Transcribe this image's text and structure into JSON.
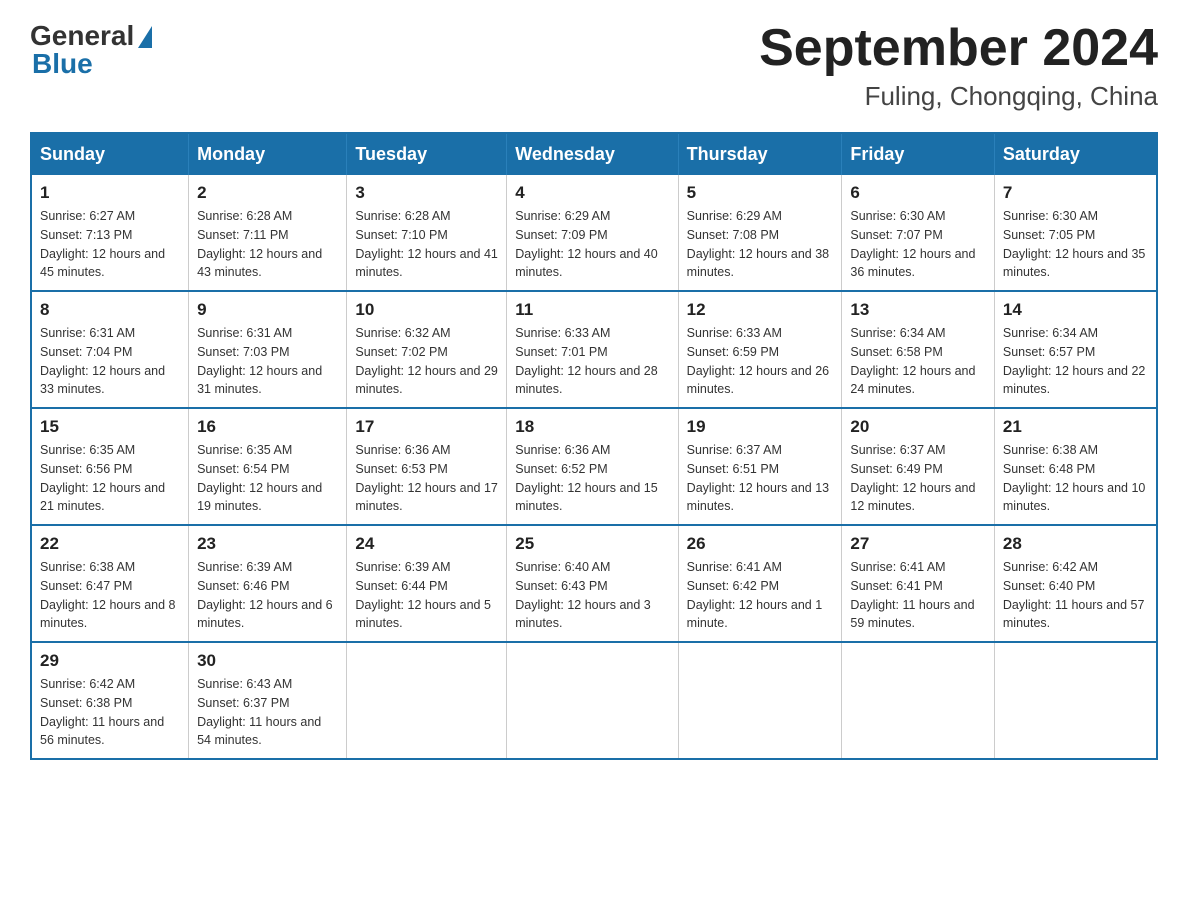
{
  "logo": {
    "general": "General",
    "blue": "Blue"
  },
  "title": "September 2024",
  "location": "Fuling, Chongqing, China",
  "days_header": [
    "Sunday",
    "Monday",
    "Tuesday",
    "Wednesday",
    "Thursday",
    "Friday",
    "Saturday"
  ],
  "weeks": [
    [
      {
        "day": "1",
        "sunrise": "6:27 AM",
        "sunset": "7:13 PM",
        "daylight": "12 hours and 45 minutes."
      },
      {
        "day": "2",
        "sunrise": "6:28 AM",
        "sunset": "7:11 PM",
        "daylight": "12 hours and 43 minutes."
      },
      {
        "day": "3",
        "sunrise": "6:28 AM",
        "sunset": "7:10 PM",
        "daylight": "12 hours and 41 minutes."
      },
      {
        "day": "4",
        "sunrise": "6:29 AM",
        "sunset": "7:09 PM",
        "daylight": "12 hours and 40 minutes."
      },
      {
        "day": "5",
        "sunrise": "6:29 AM",
        "sunset": "7:08 PM",
        "daylight": "12 hours and 38 minutes."
      },
      {
        "day": "6",
        "sunrise": "6:30 AM",
        "sunset": "7:07 PM",
        "daylight": "12 hours and 36 minutes."
      },
      {
        "day": "7",
        "sunrise": "6:30 AM",
        "sunset": "7:05 PM",
        "daylight": "12 hours and 35 minutes."
      }
    ],
    [
      {
        "day": "8",
        "sunrise": "6:31 AM",
        "sunset": "7:04 PM",
        "daylight": "12 hours and 33 minutes."
      },
      {
        "day": "9",
        "sunrise": "6:31 AM",
        "sunset": "7:03 PM",
        "daylight": "12 hours and 31 minutes."
      },
      {
        "day": "10",
        "sunrise": "6:32 AM",
        "sunset": "7:02 PM",
        "daylight": "12 hours and 29 minutes."
      },
      {
        "day": "11",
        "sunrise": "6:33 AM",
        "sunset": "7:01 PM",
        "daylight": "12 hours and 28 minutes."
      },
      {
        "day": "12",
        "sunrise": "6:33 AM",
        "sunset": "6:59 PM",
        "daylight": "12 hours and 26 minutes."
      },
      {
        "day": "13",
        "sunrise": "6:34 AM",
        "sunset": "6:58 PM",
        "daylight": "12 hours and 24 minutes."
      },
      {
        "day": "14",
        "sunrise": "6:34 AM",
        "sunset": "6:57 PM",
        "daylight": "12 hours and 22 minutes."
      }
    ],
    [
      {
        "day": "15",
        "sunrise": "6:35 AM",
        "sunset": "6:56 PM",
        "daylight": "12 hours and 21 minutes."
      },
      {
        "day": "16",
        "sunrise": "6:35 AM",
        "sunset": "6:54 PM",
        "daylight": "12 hours and 19 minutes."
      },
      {
        "day": "17",
        "sunrise": "6:36 AM",
        "sunset": "6:53 PM",
        "daylight": "12 hours and 17 minutes."
      },
      {
        "day": "18",
        "sunrise": "6:36 AM",
        "sunset": "6:52 PM",
        "daylight": "12 hours and 15 minutes."
      },
      {
        "day": "19",
        "sunrise": "6:37 AM",
        "sunset": "6:51 PM",
        "daylight": "12 hours and 13 minutes."
      },
      {
        "day": "20",
        "sunrise": "6:37 AM",
        "sunset": "6:49 PM",
        "daylight": "12 hours and 12 minutes."
      },
      {
        "day": "21",
        "sunrise": "6:38 AM",
        "sunset": "6:48 PM",
        "daylight": "12 hours and 10 minutes."
      }
    ],
    [
      {
        "day": "22",
        "sunrise": "6:38 AM",
        "sunset": "6:47 PM",
        "daylight": "12 hours and 8 minutes."
      },
      {
        "day": "23",
        "sunrise": "6:39 AM",
        "sunset": "6:46 PM",
        "daylight": "12 hours and 6 minutes."
      },
      {
        "day": "24",
        "sunrise": "6:39 AM",
        "sunset": "6:44 PM",
        "daylight": "12 hours and 5 minutes."
      },
      {
        "day": "25",
        "sunrise": "6:40 AM",
        "sunset": "6:43 PM",
        "daylight": "12 hours and 3 minutes."
      },
      {
        "day": "26",
        "sunrise": "6:41 AM",
        "sunset": "6:42 PM",
        "daylight": "12 hours and 1 minute."
      },
      {
        "day": "27",
        "sunrise": "6:41 AM",
        "sunset": "6:41 PM",
        "daylight": "11 hours and 59 minutes."
      },
      {
        "day": "28",
        "sunrise": "6:42 AM",
        "sunset": "6:40 PM",
        "daylight": "11 hours and 57 minutes."
      }
    ],
    [
      {
        "day": "29",
        "sunrise": "6:42 AM",
        "sunset": "6:38 PM",
        "daylight": "11 hours and 56 minutes."
      },
      {
        "day": "30",
        "sunrise": "6:43 AM",
        "sunset": "6:37 PM",
        "daylight": "11 hours and 54 minutes."
      },
      null,
      null,
      null,
      null,
      null
    ]
  ]
}
